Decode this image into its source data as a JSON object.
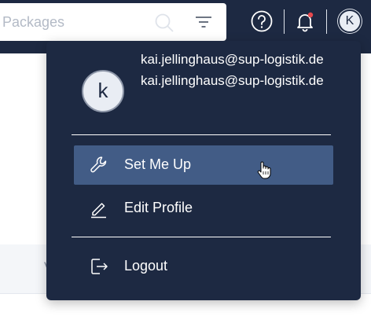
{
  "header": {
    "search_placeholder": "h Packages",
    "icons": [
      "search-icon",
      "filter-icon",
      "help-icon",
      "notification-bell-icon"
    ],
    "avatar_initial": "K",
    "colors": {
      "nav_background": "#1d2942",
      "notification_dot": "#e5484d"
    }
  },
  "background": {
    "partial_text": "V"
  },
  "profile_menu": {
    "avatar_initial": "k",
    "email_primary": "kai.jellinghaus@sup-logistik.de",
    "email_secondary": "kai.jellinghaus@sup-logistik.de",
    "items": [
      {
        "label": "Set Me Up",
        "icon": "wrench-icon",
        "active": true
      },
      {
        "label": "Edit Profile",
        "icon": "pencil-icon",
        "active": false
      },
      {
        "label": "Logout",
        "icon": "logout-icon",
        "active": false
      }
    ],
    "colors": {
      "menu_background": "#1d2942",
      "active_item": "#425c86"
    }
  }
}
